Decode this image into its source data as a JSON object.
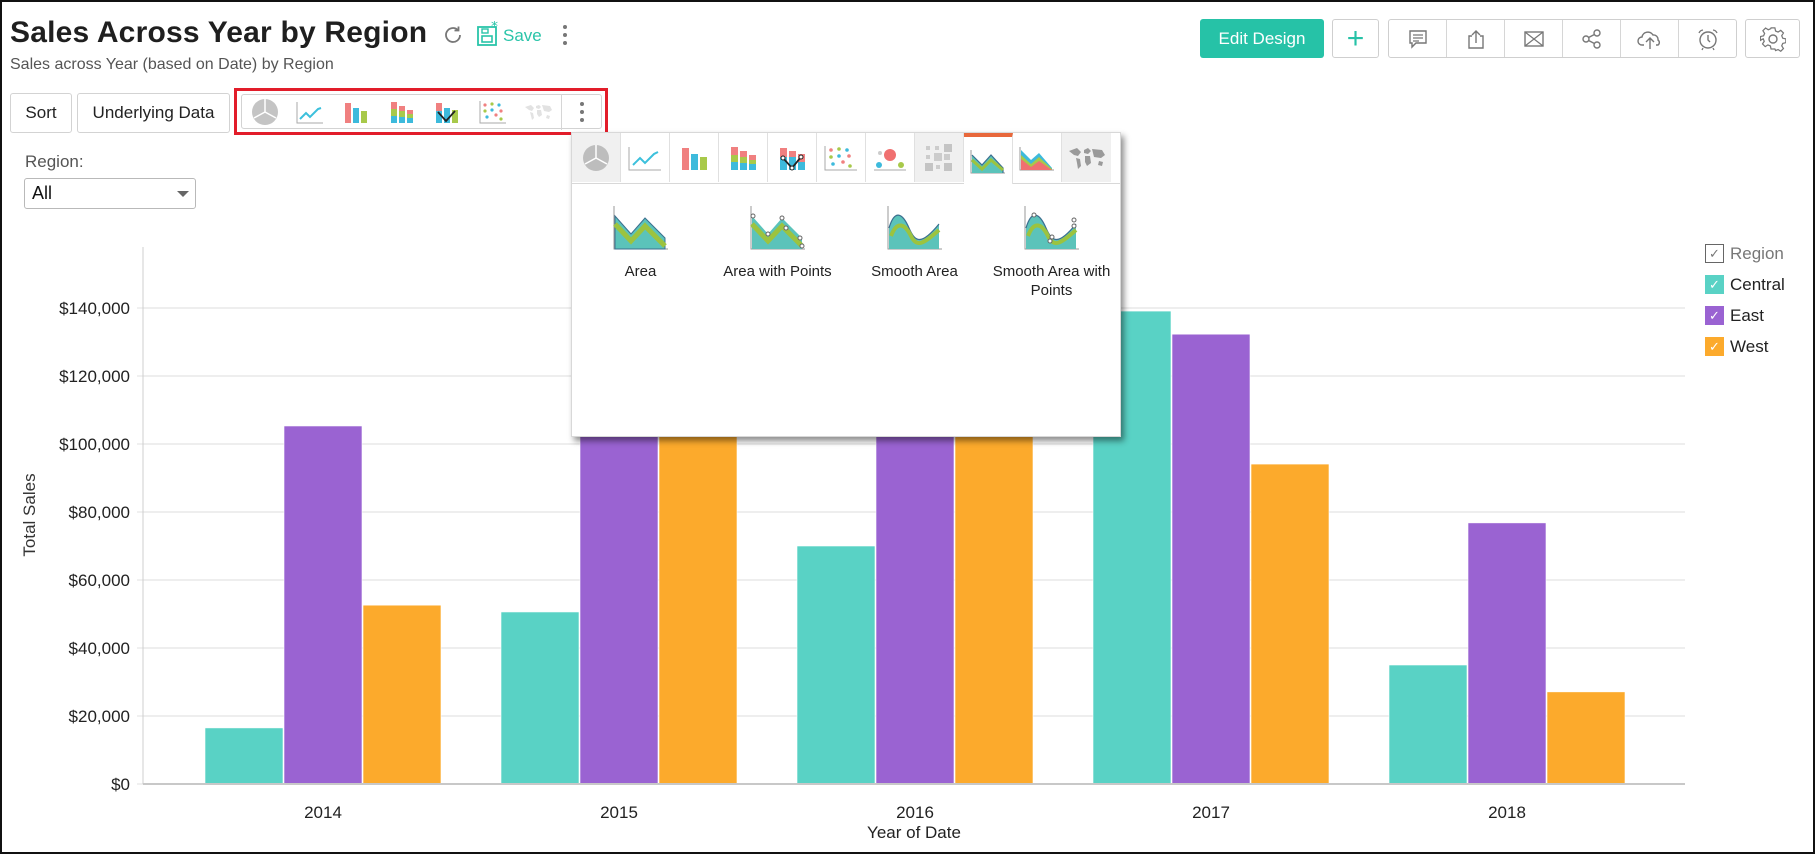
{
  "header": {
    "title": "Sales Across Year by Region",
    "subtitle": "Sales across Year (based on Date) by Region",
    "save_label": "Save",
    "edit_design_label": "Edit Design",
    "icons": [
      "refresh-icon",
      "save-icon",
      "more-vertical-icon",
      "plus-icon",
      "comment-icon",
      "export-icon",
      "email-icon",
      "share-icon",
      "publish-cloud-icon",
      "schedule-alarm-icon",
      "settings-gear-icon"
    ]
  },
  "toolbar": {
    "sort_label": "Sort",
    "underlying_data_label": "Underlying Data",
    "chart_types": [
      "pie",
      "line",
      "bar",
      "stacked-bar",
      "combination",
      "scatter",
      "map"
    ]
  },
  "filter": {
    "label": "Region:",
    "selected": "All"
  },
  "chart_popup": {
    "tabs": [
      "pie",
      "line",
      "bar",
      "stacked-bar",
      "combination",
      "scatter",
      "bubble",
      "heatmap",
      "area",
      "stacked-area",
      "map"
    ],
    "active_tab": "area",
    "disabled_tabs": [
      "pie",
      "heatmap",
      "map"
    ],
    "variants": [
      {
        "label_line1": "Area",
        "label_line2": ""
      },
      {
        "label_line1": "Area with Points",
        "label_line2": ""
      },
      {
        "label_line1": "Smooth Area",
        "label_line2": ""
      },
      {
        "label_line1": "Smooth Area with",
        "label_line2": "Points"
      }
    ]
  },
  "legend": {
    "title": "Region",
    "items": [
      {
        "label": "Central",
        "color": "#59d2c5"
      },
      {
        "label": "East",
        "color": "#9a63d2"
      },
      {
        "label": "West",
        "color": "#fcaa2c"
      }
    ]
  },
  "chart_data": {
    "type": "bar",
    "title": "Sales Across Year by Region",
    "xlabel": "Year of Date",
    "ylabel": "Total Sales",
    "categories": [
      "2014",
      "2015",
      "2016",
      "2017",
      "2018"
    ],
    "series": [
      {
        "name": "Central",
        "color": "#59d2c5",
        "values": [
          16500,
          50600,
          70000,
          139100,
          35000
        ]
      },
      {
        "name": "East",
        "color": "#9a63d2",
        "values": [
          105300,
          128000,
          156000,
          132300,
          76800
        ]
      },
      {
        "name": "West",
        "color": "#fcaa2c",
        "values": [
          52600,
          110000,
          125000,
          94100,
          27100
        ]
      }
    ],
    "ylim": [
      0,
      160000
    ],
    "yticks": [
      0,
      20000,
      40000,
      60000,
      80000,
      100000,
      120000,
      140000
    ],
    "ytick_labels": [
      "$0",
      "$20,000",
      "$40,000",
      "$60,000",
      "$80,000",
      "$100,000",
      "$120,000",
      "$140,000"
    ],
    "grid": true,
    "legend_position": "right"
  }
}
